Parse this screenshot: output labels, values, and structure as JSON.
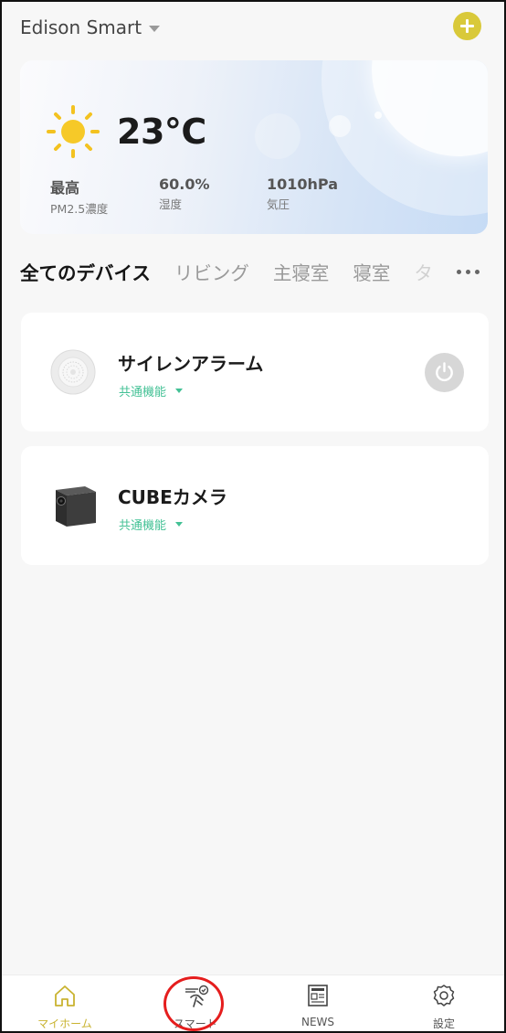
{
  "header": {
    "home_name": "Edison Smart",
    "add_icon": "plus-icon",
    "accent_color": "#d9c93a"
  },
  "weather": {
    "icon": "sun-icon",
    "temperature": "23°C",
    "stats": [
      {
        "value": "最高",
        "label": "PM2.5濃度"
      },
      {
        "value": "60.0%",
        "label": "湿度"
      },
      {
        "value": "1010hPa",
        "label": "気圧"
      }
    ]
  },
  "tabs": {
    "items": [
      "全てのデバイス",
      "リビング",
      "主寝室",
      "寝室",
      "タ"
    ],
    "active": "全てのデバイス",
    "more_icon": "more-dots-icon"
  },
  "devices": [
    {
      "name": "サイレンアラーム",
      "function_label": "共通機能",
      "icon": "siren-alarm-icon",
      "power_icon": "power-icon"
    },
    {
      "name": "CUBEカメラ",
      "function_label": "共通機能",
      "icon": "cube-camera-icon"
    }
  ],
  "nav": {
    "items": [
      {
        "label": "マイホーム",
        "icon": "home-icon"
      },
      {
        "label": "スマート",
        "icon": "smart-icon"
      },
      {
        "label": "NEWS",
        "icon": "news-icon"
      },
      {
        "label": "設定",
        "icon": "settings-gear-icon"
      }
    ],
    "active_color": "#c9b330",
    "highlight_color": "#e51d1d"
  }
}
